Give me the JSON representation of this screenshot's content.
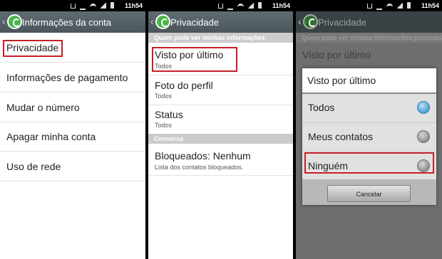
{
  "status_time": "11h54",
  "screen1": {
    "title": "Informações da conta",
    "items": [
      "Privacidade",
      "Informações de pagamento",
      "Mudar o número",
      "Apagar minha conta",
      "Uso de rede"
    ]
  },
  "screen2": {
    "title": "Privacidade",
    "section1": "Quem pode ver minhas informações pessoais",
    "items": [
      {
        "title": "Visto por último",
        "subtitle": "Todos"
      },
      {
        "title": "Foto do perfil",
        "subtitle": "Todos"
      },
      {
        "title": "Status",
        "subtitle": "Todos"
      }
    ],
    "section2": "Conversa",
    "blocked": {
      "title": "Bloqueados: Nenhum",
      "subtitle": "Lista dos contatos bloqueados."
    }
  },
  "screen3": {
    "title": "Privacidade",
    "section1": "Quem pode ver minhas informações pessoais",
    "behind_item": "Visto por último",
    "dialog": {
      "title": "Visto por último",
      "options": [
        "Todos",
        "Meus contatos",
        "Ninguém"
      ],
      "selected": "Todos",
      "cancel": "Cancelar"
    }
  },
  "colors": {
    "highlight": "#c81f26",
    "actionbar": "#56636a",
    "radio_selected": "#4a9fd4",
    "whatsapp_green": "#4bb54a"
  }
}
